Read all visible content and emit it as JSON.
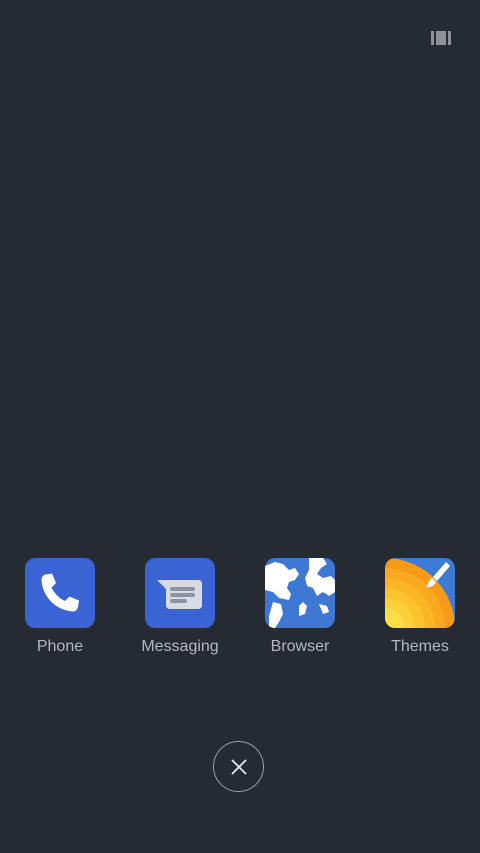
{
  "colors": {
    "background": "#262a32",
    "label": "#b4b7bd",
    "phone_tile": "#3a64d3",
    "messaging_tile": "#3a64d3",
    "browser_tile": "#3f78d4",
    "themes_tile": "#f7a51d",
    "themes_accent": "#3d7cd6"
  },
  "toolbar": {
    "recents_icon": "recents-toggle-icon"
  },
  "dock": {
    "apps": [
      {
        "label": "Phone",
        "icon": "phone-icon"
      },
      {
        "label": "Messaging",
        "icon": "messaging-icon"
      },
      {
        "label": "Browser",
        "icon": "browser-icon"
      },
      {
        "label": "Themes",
        "icon": "themes-icon"
      }
    ]
  },
  "close": {
    "icon": "close-icon"
  }
}
